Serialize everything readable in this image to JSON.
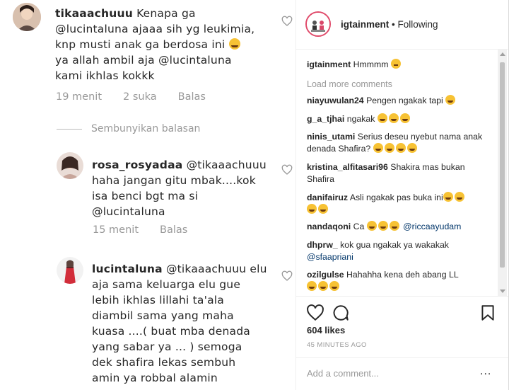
{
  "left_panel": {
    "comments": [
      {
        "username": "tikaaachuuu",
        "lines": [
          "Kenapa ga",
          "@lucintaluna ajaaa sih yg leukimia,",
          "knp musti anak ga berdosa ini",
          "ya allah ambil aja @lucintaluna",
          "kami ikhlas kokkk"
        ],
        "time": "19 menit",
        "likes": "2 suka",
        "reply": "Balas"
      },
      {
        "username": "rosa_rosyadaa",
        "lines": [
          "@tikaaachuuu",
          "haha jangan gitu mbak....kok",
          "isa benci bgt ma si",
          "@lucintaluna"
        ],
        "time": "15 menit",
        "reply": "Balas"
      },
      {
        "username": "lucintaluna",
        "lines": [
          "@tikaaachuuu elu",
          "aja sama keluarga elu gue",
          "lebih ikhlas lillahi ta'ala",
          "diambil sama yang maha",
          "kuasa ....( buat mba denada",
          "yang sabar ya ... ) semoga",
          "dek shafira lekas sembuh",
          "amin ya robbal alamin"
        ]
      }
    ],
    "hide_replies": "Sembunyikan balasan"
  },
  "right_panel": {
    "header": {
      "username": "igtainment",
      "separator": "•",
      "follow_status": "Following"
    },
    "caption": {
      "username": "igtainment",
      "text": "Hmmmm"
    },
    "load_more": "Load more comments",
    "comments": [
      {
        "username": "niayuwulan24",
        "text": "Pengen ngakak tapi"
      },
      {
        "username": "g_a_tjhai",
        "text": "ngakak"
      },
      {
        "username": "ninis_utami",
        "text": "Serius deseu nyebut nama anak denada Shafira?"
      },
      {
        "username": "kristina_alfitasari96",
        "text": "Shakira mas bukan Shafira"
      },
      {
        "username": "danifairuz",
        "text": "Asli ngakak pas buka ini"
      },
      {
        "username": "nandaqoni",
        "text": "Ca",
        "mention": "@riccaayudam"
      },
      {
        "username": "dhprw_",
        "text": "kok gua ngakak ya wakakak",
        "mention": "@sfaapriani"
      },
      {
        "username": "ozilgulse",
        "text": "Hahahha kena deh abang LL"
      }
    ],
    "likes": "604 likes",
    "time": "45 MINUTES AGO",
    "add_comment_placeholder": "Add a comment...",
    "more_label": "..."
  },
  "icons": [
    "heart-icon",
    "comment-icon",
    "bookmark-icon",
    "more-icon"
  ],
  "colors": {
    "mention": "#003569",
    "meta_gray": "#999999",
    "story_ring": "#e04a6a"
  }
}
